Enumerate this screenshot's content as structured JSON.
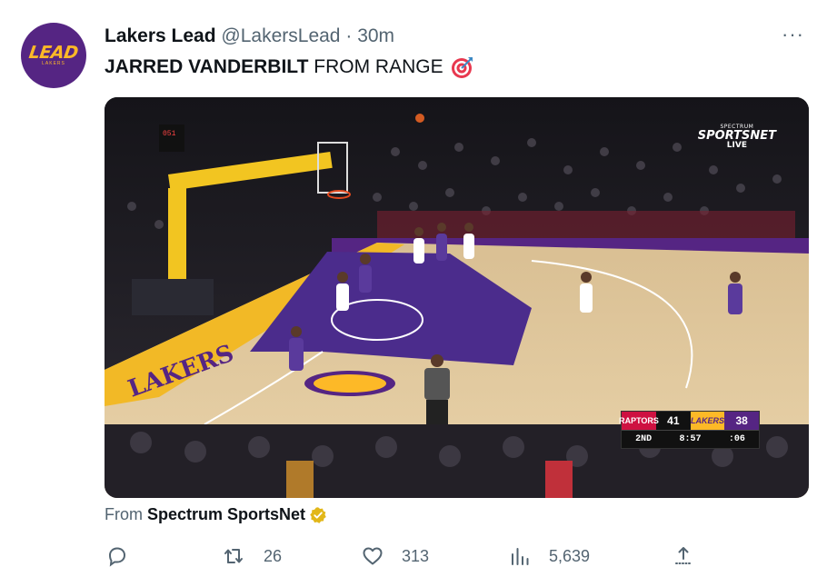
{
  "tweet": {
    "author_name": "Lakers Lead",
    "author_handle": "@LakersLead",
    "separator": "·",
    "time": "30m",
    "text_bold": "JARRED VANDERBILT",
    "text_rest": "FROM RANGE",
    "emoji_icon": "direct-hit-target-icon",
    "avatar_text": "LEAD",
    "avatar_subtext": "LAKERS",
    "more_label": "···"
  },
  "media": {
    "network_top": "SPECTRUM",
    "network_main": "SPORTSNET",
    "network_live": "LIVE",
    "scorebug": {
      "away_team": "RAPTORS",
      "away_score": "41",
      "home_team": "LAKERS",
      "home_score": "38",
      "quarter": "2ND",
      "clock": "8:57",
      "shot_clock": ":06"
    },
    "colors": {
      "lakers_purple": "#552583",
      "lakers_gold": "#fdb927",
      "raptors_red": "#ce1141"
    }
  },
  "source": {
    "prefix": "From",
    "name": "Spectrum SportsNet",
    "badge_icon": "verified-gold-icon"
  },
  "actions": {
    "reply": {
      "icon": "reply-icon",
      "count": ""
    },
    "retweet": {
      "icon": "retweet-icon",
      "count": "26"
    },
    "like": {
      "icon": "heart-icon",
      "count": "313"
    },
    "views": {
      "icon": "analytics-icon",
      "count": "5,639"
    },
    "share": {
      "icon": "share-icon",
      "count": ""
    }
  }
}
